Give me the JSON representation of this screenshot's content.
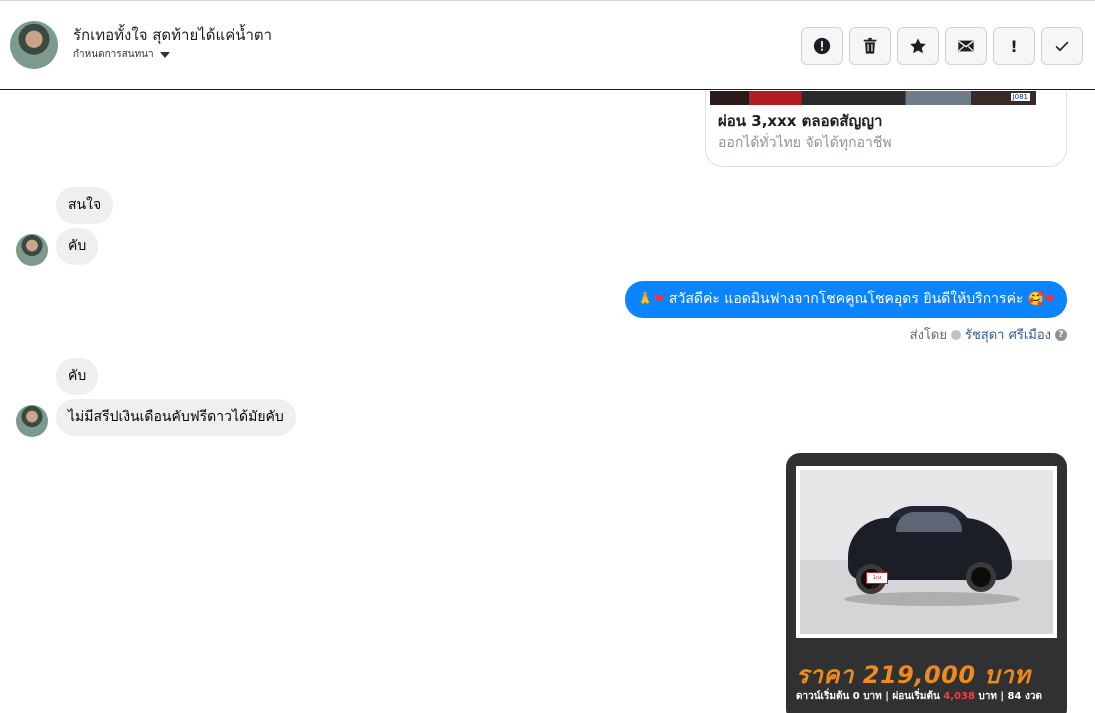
{
  "header": {
    "contact_name": "รักเทอทั้งใจ สุดท้ายได้แค่น้ำตา",
    "assign_label": "กำหนดการสนทนา",
    "toolbar": [
      {
        "name": "spam-button",
        "icon": "alert-circle-icon"
      },
      {
        "name": "delete-button",
        "icon": "trash-icon"
      },
      {
        "name": "star-button",
        "icon": "star-icon"
      },
      {
        "name": "mark-unread-button",
        "icon": "envelope-icon"
      },
      {
        "name": "follow-up-button",
        "icon": "exclamation-icon",
        "glyph": "!"
      },
      {
        "name": "done-button",
        "icon": "check-icon"
      }
    ]
  },
  "product_card": {
    "line1": "ผ่อน 3,xxx ตลอดสัญญา",
    "line2": "ออกได้ทั่วไทย จัดได้ทุกอาชีพ",
    "plate_tag": "J081"
  },
  "messages": [
    {
      "dir": "in",
      "text": "สนใจ"
    },
    {
      "dir": "in",
      "text": "คับ"
    },
    {
      "dir": "out",
      "text": "สวัสดีค่ะ แอดมินฟางจากโชคคูณโชคอุดร ยินดีให้บริการค่ะ"
    },
    {
      "dir": "in",
      "text": "คับ"
    },
    {
      "dir": "in",
      "text": "ไม่มีสรีปเงินเดือนคับฟรีดาวได้มัยคับ"
    }
  ],
  "sent_by": {
    "label": "ส่งโดย",
    "agent": "รัชสุดา ศรีเมือง"
  },
  "promo": {
    "price": "ราคา 219,000 บาท",
    "terms_a": "ดาวน์เริ่มต้น 0 บาท | ผ่อนเริ่มต้น ",
    "terms_highlight": "4,038",
    "terms_b": " บาท | 84 งวด",
    "plate": "1กง 2137"
  },
  "colors": {
    "outgoing_bubble": "#0b84ff",
    "incoming_bubble": "#efefef",
    "promo_price": "#f08a1c",
    "promo_bg": "#2f3133"
  }
}
